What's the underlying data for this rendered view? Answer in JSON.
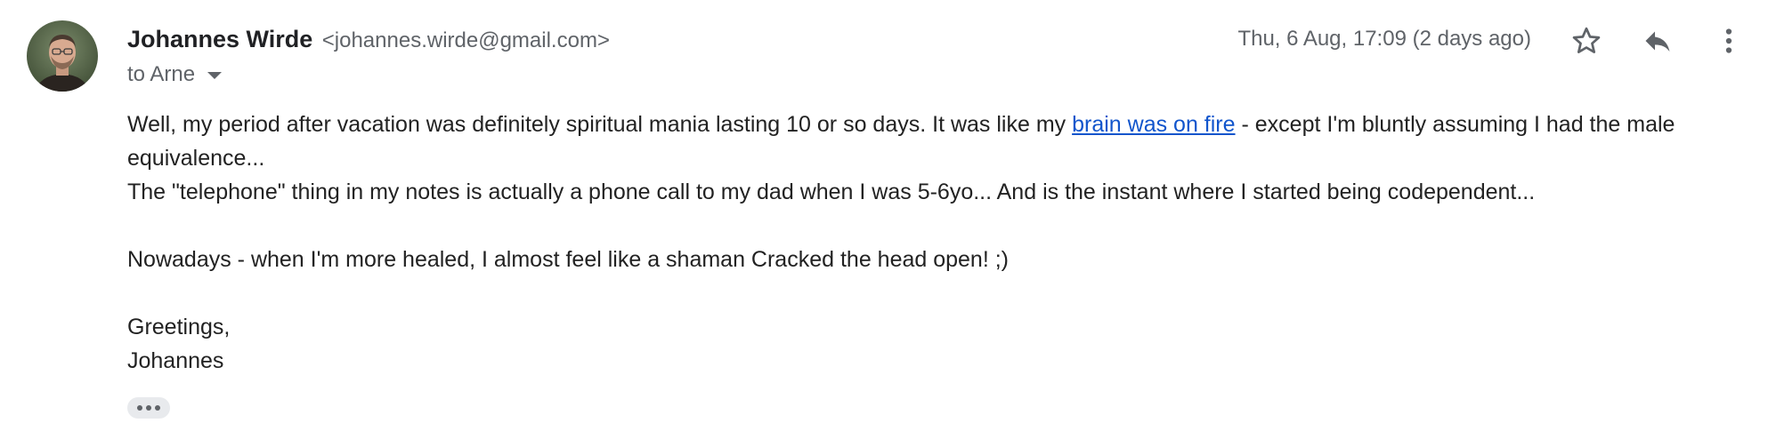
{
  "sender": {
    "name": "Johannes Wirde",
    "email": "<johannes.wirde@gmail.com>"
  },
  "recipient": {
    "label": "to Arne"
  },
  "date": "Thu, 6 Aug, 17:09 (2 days ago)",
  "actions": {
    "star_icon": "star-outline-icon",
    "reply_icon": "reply-icon",
    "more_icon": "more-vert-icon"
  },
  "body": {
    "p1_before_link": "Well, my period after vacation was definitely spiritual mania lasting 10 or so days. It was like my ",
    "p1_link": "brain was on fire",
    "p1_after_link": " - except I'm bluntly assuming I had the male equivalence...",
    "p2": "The \"telephone\" thing in my notes is actually a phone call to my dad when I was 5-6yo... And is the instant where I started being codependent...",
    "p3": "Nowadays - when I'm more healed, I almost feel like a shaman Cracked the head open! ;)",
    "greeting": "Greetings,",
    "signature": "Johannes"
  },
  "colors": {
    "link": "#1155cc",
    "muted": "#5f6368",
    "text": "#222222"
  }
}
